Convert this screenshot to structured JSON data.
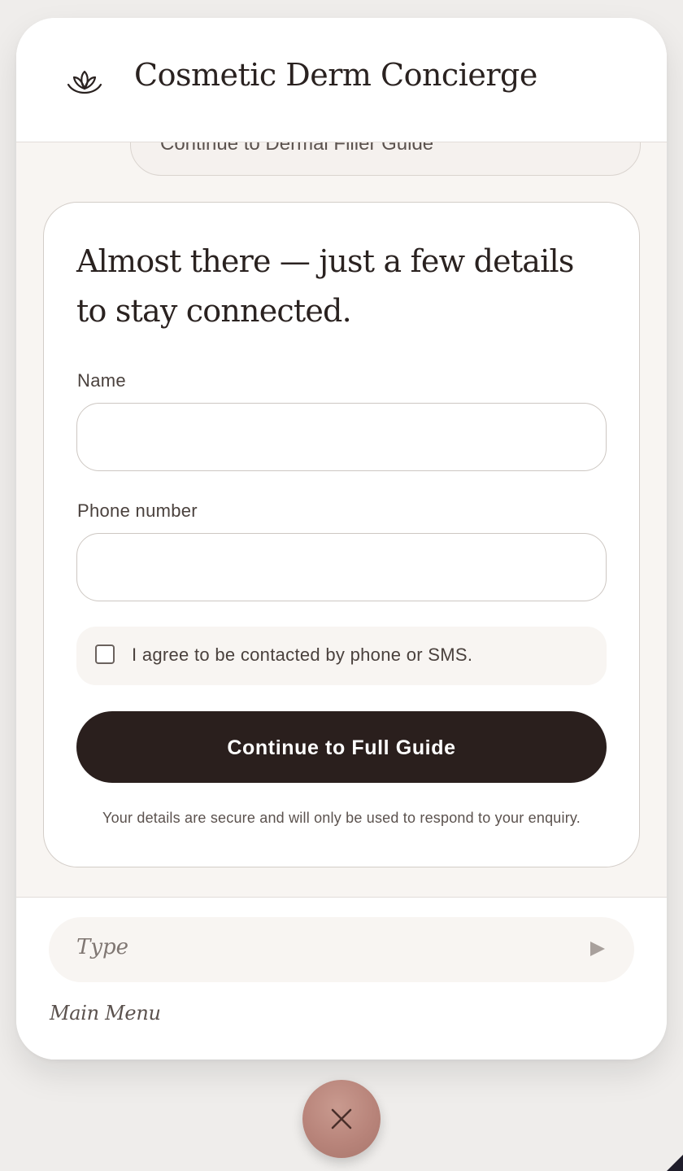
{
  "header": {
    "logo_icon": "lotus-icon",
    "title": "Cosmetic Derm Concierge"
  },
  "chat": {
    "previous_message": "Continue to Dermal Filler Guide"
  },
  "lead_form": {
    "title": "Almost there — just a few details to stay connected.",
    "name_label": "Name",
    "name_value": "",
    "phone_label": "Phone number",
    "phone_value": "",
    "consent_checked": false,
    "consent_label": "I agree to be contacted by phone or SMS.",
    "submit_label": "Continue to Full Guide",
    "privacy_note": "Your details are secure and will only be used to respond to your enquiry."
  },
  "composer": {
    "placeholder": "Type",
    "send_icon": "send-icon"
  },
  "footer": {
    "main_menu_label": "Main Menu"
  },
  "fab": {
    "icon": "close-icon"
  },
  "colors": {
    "accent": "#b8847a",
    "button_dark": "#2a1f1d",
    "surface": "#f8f5f2"
  }
}
